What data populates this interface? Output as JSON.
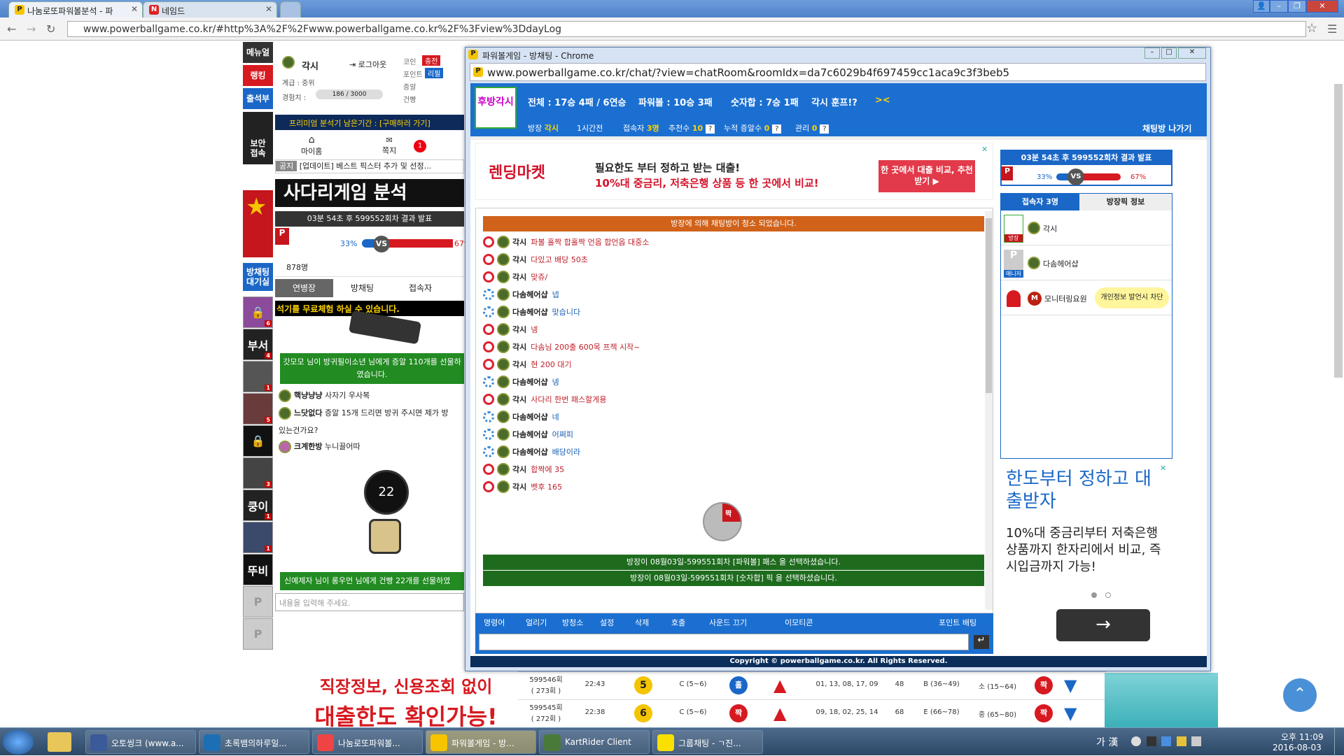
{
  "browser": {
    "tabs": [
      {
        "label": "나눔로또파워볼분석 - 파",
        "favicon": "P"
      },
      {
        "label": "네임드",
        "favicon": "N"
      }
    ],
    "url": "www.powerballgame.co.kr/#http%3A%2F%2Fwww.powerballgame.co.kr%2F%3Fview%3DdayLog"
  },
  "left": {
    "menu": "메뉴얼",
    "ranking": "랭킹",
    "attendance": "출석부",
    "security": "보안\n접속",
    "user": {
      "name": "각시",
      "logout": "로그아웃",
      "class": "계급 : 중위",
      "exp_label": "경험치 :",
      "exp": "186 / 3000"
    },
    "wallet": {
      "coin": "코인",
      "charge": "충전",
      "point": "포인트",
      "refill": "리필",
      "gift": "증알",
      "history": "건빵"
    },
    "premium": "프리미엄 분석기 남은기간 : [구매하러 가기]",
    "mypage": "마이홈",
    "note": "쪽지",
    "note_count": "1",
    "notice_label": "공지",
    "notice": "[업데이트] 베스트 픽스터 추가 및 선정...",
    "banner_title": "사다리게임 분석",
    "round_text": "03분 54초 후 599552회차 결과 발표",
    "pct_left": "33%",
    "pct_right": "67%",
    "chatroom_side": "방채팅\n대기실",
    "users_count": "878명",
    "tabs": [
      "연병장",
      "방채팅",
      "접속자"
    ],
    "promo_text": "석기를 무료체험 하실 수 있습니다.",
    "gift_msg1": "갓모모 님이 방귀필이소년 님에게 증알 110개를 선물하였습니다.",
    "chats": [
      {
        "name": "핵냥냥냥",
        "text": "사자기 우사복"
      },
      {
        "name": "느닷없다",
        "text": "증알 15개 드리면 방귀 주시면 제가 방"
      },
      {
        "name": "",
        "text": "있는건가요?"
      },
      {
        "name": "크계한방",
        "text": "누니끌어따"
      }
    ],
    "timer": "22",
    "gift_msg2": "신예제자 님이 롱우먼 님에게 건빵 22개를 선물하였",
    "input_placeholder": "내용을 입력해 주세요.",
    "thumbs": [
      {
        "label": "",
        "n": "6"
      },
      {
        "label": "부서",
        "n": "4"
      },
      {
        "label": "",
        "n": "1"
      },
      {
        "label": "",
        "n": "5"
      },
      {
        "label": "",
        "n": ""
      },
      {
        "label": "",
        "n": "3"
      },
      {
        "label": "쿵이",
        "n": "1"
      },
      {
        "label": "",
        "n": "1"
      },
      {
        "label": "뚜비",
        "n": ""
      }
    ],
    "ad_line1": "직장정보, 신용조회 없이",
    "ad_line2": "대출한도 확인가능!"
  },
  "popup": {
    "title": "파워볼게임 - 방채팅 - Chrome",
    "url": "www.powerballgame.co.kr/chat/?view=chatRoom&roomIdx=da7c6029b4f697459cc1aca9c3f3beb5",
    "logo": "후방각시",
    "stats": {
      "total": "전체 : 17승 4패 / 6연승",
      "powerball": "파워볼 : 10승 3패",
      "number": "숫자합 : 7승 1패",
      "room_title": "각시 훈프!?",
      "arrows": "><"
    },
    "sub": {
      "owner_label": "방장",
      "owner": "각시",
      "time": "1시간전",
      "users_label": "접속자",
      "users": "3명",
      "rec_label": "추천수",
      "rec": "10",
      "acc_label": "누적 증알수",
      "acc": "0",
      "mgr_label": "관리",
      "mgr": "0",
      "exit": "채팅방 나가기"
    },
    "ad": {
      "small": "렌딩마켓",
      "line1": "필요한도 부터 정하고 받는 대출!",
      "line2": "10%대 중금리, 저축은행 상품 등 한 곳에서 비교!",
      "cta": "한 곳에서 대출 비교, 추천받기 ▶"
    },
    "clean_notice": "방장에 의해 채팅방이 청소 되었습니다.",
    "messages": [
      {
        "type": "red",
        "name": "각시",
        "text": "파볼 홀짝 합홀짝 언옵 합언옵 대중소"
      },
      {
        "type": "red",
        "name": "각시",
        "text": "다있고 배당 50초"
      },
      {
        "type": "red",
        "name": "각시",
        "text": "맞쥬/"
      },
      {
        "type": "blue",
        "name": "다솜헤어샵",
        "text": "넵"
      },
      {
        "type": "blue",
        "name": "다솜헤어샵",
        "text": "맞습니다"
      },
      {
        "type": "red",
        "name": "각시",
        "text": "넹"
      },
      {
        "type": "red",
        "name": "각시",
        "text": "다솜님 200출 600목 프젝 시작~"
      },
      {
        "type": "red",
        "name": "각시",
        "text": "현 200 대기"
      },
      {
        "type": "blue",
        "name": "다솜헤어샵",
        "text": "넹"
      },
      {
        "type": "red",
        "name": "각시",
        "text": "사다리 한번 패스할게용"
      },
      {
        "type": "blue",
        "name": "다솜헤어샵",
        "text": "네"
      },
      {
        "type": "blue",
        "name": "다솜헤어샵",
        "text": "어쩌피"
      },
      {
        "type": "blue",
        "name": "다솜헤어샵",
        "text": "배당이라"
      },
      {
        "type": "red",
        "name": "각시",
        "text": "합짝에 35"
      },
      {
        "type": "red",
        "name": "각시",
        "text": "벳후 165"
      }
    ],
    "pick": "짝",
    "pass1": "방장이 08월03일-599551회차 [파워볼] 패스 을 선택하셨습니다.",
    "pass2": "방장이 08월03일-599551회차 [숫자합] 픽 을 선택하셨습니다.",
    "buttons": [
      "명령어",
      "얼리기",
      "방청소",
      "설정",
      "삭제",
      "호출",
      "사운드 끄기",
      "이모티콘",
      "포인트 배팅"
    ],
    "footer": "Copyright © powerballgame.co.kr. All Rights Reserved.",
    "right": {
      "round": "03분 54초 후 599552회차 결과 발표",
      "pct_left": "33%",
      "pct_right": "67%",
      "tab_users": "접속자 3명",
      "tab_info": "방장픽 정보",
      "users": [
        {
          "tag": "방장",
          "name": "각시"
        },
        {
          "tag": "매니저",
          "name": "다솜헤어샵"
        },
        {
          "tag": "",
          "name": "모니터링요원",
          "note": "개인정보 발언시 차단"
        }
      ],
      "ad_title": "한도부터 정하고 대출받자",
      "ad_body": "10%대 중금리부터 저축은행 상품까지 한자리에서 비교, 즉시입금까지 가능!"
    }
  },
  "table": [
    {
      "round": "599546회",
      "sub": "( 273회 )",
      "time": "22:43",
      "ball": "5",
      "size": "C (5~6)",
      "oe": "홀",
      "nums": "01, 13, 08, 17, 09",
      "sum": "48",
      "sec": "B (36~49)",
      "sz": "소 (15~64)",
      "res": "짝"
    },
    {
      "round": "599545회",
      "sub": "( 272회 )",
      "time": "22:38",
      "ball": "6",
      "size": "C (5~6)",
      "oe": "짝",
      "nums": "09, 18, 02, 25, 14",
      "sum": "68",
      "sec": "E (66~78)",
      "sz": "중 (65~80)",
      "res": "짝"
    }
  ],
  "taskbar": {
    "items": [
      "오토씽크 (www.a...",
      "초록뱀의하루일...",
      "나눔로또파워볼...",
      "파워볼게임 - 방...",
      "KartRider Client",
      "그룹채팅 - ㄱ진..."
    ],
    "lang": "가 漢",
    "time": "오후 11:09",
    "date": "2016-08-03"
  }
}
